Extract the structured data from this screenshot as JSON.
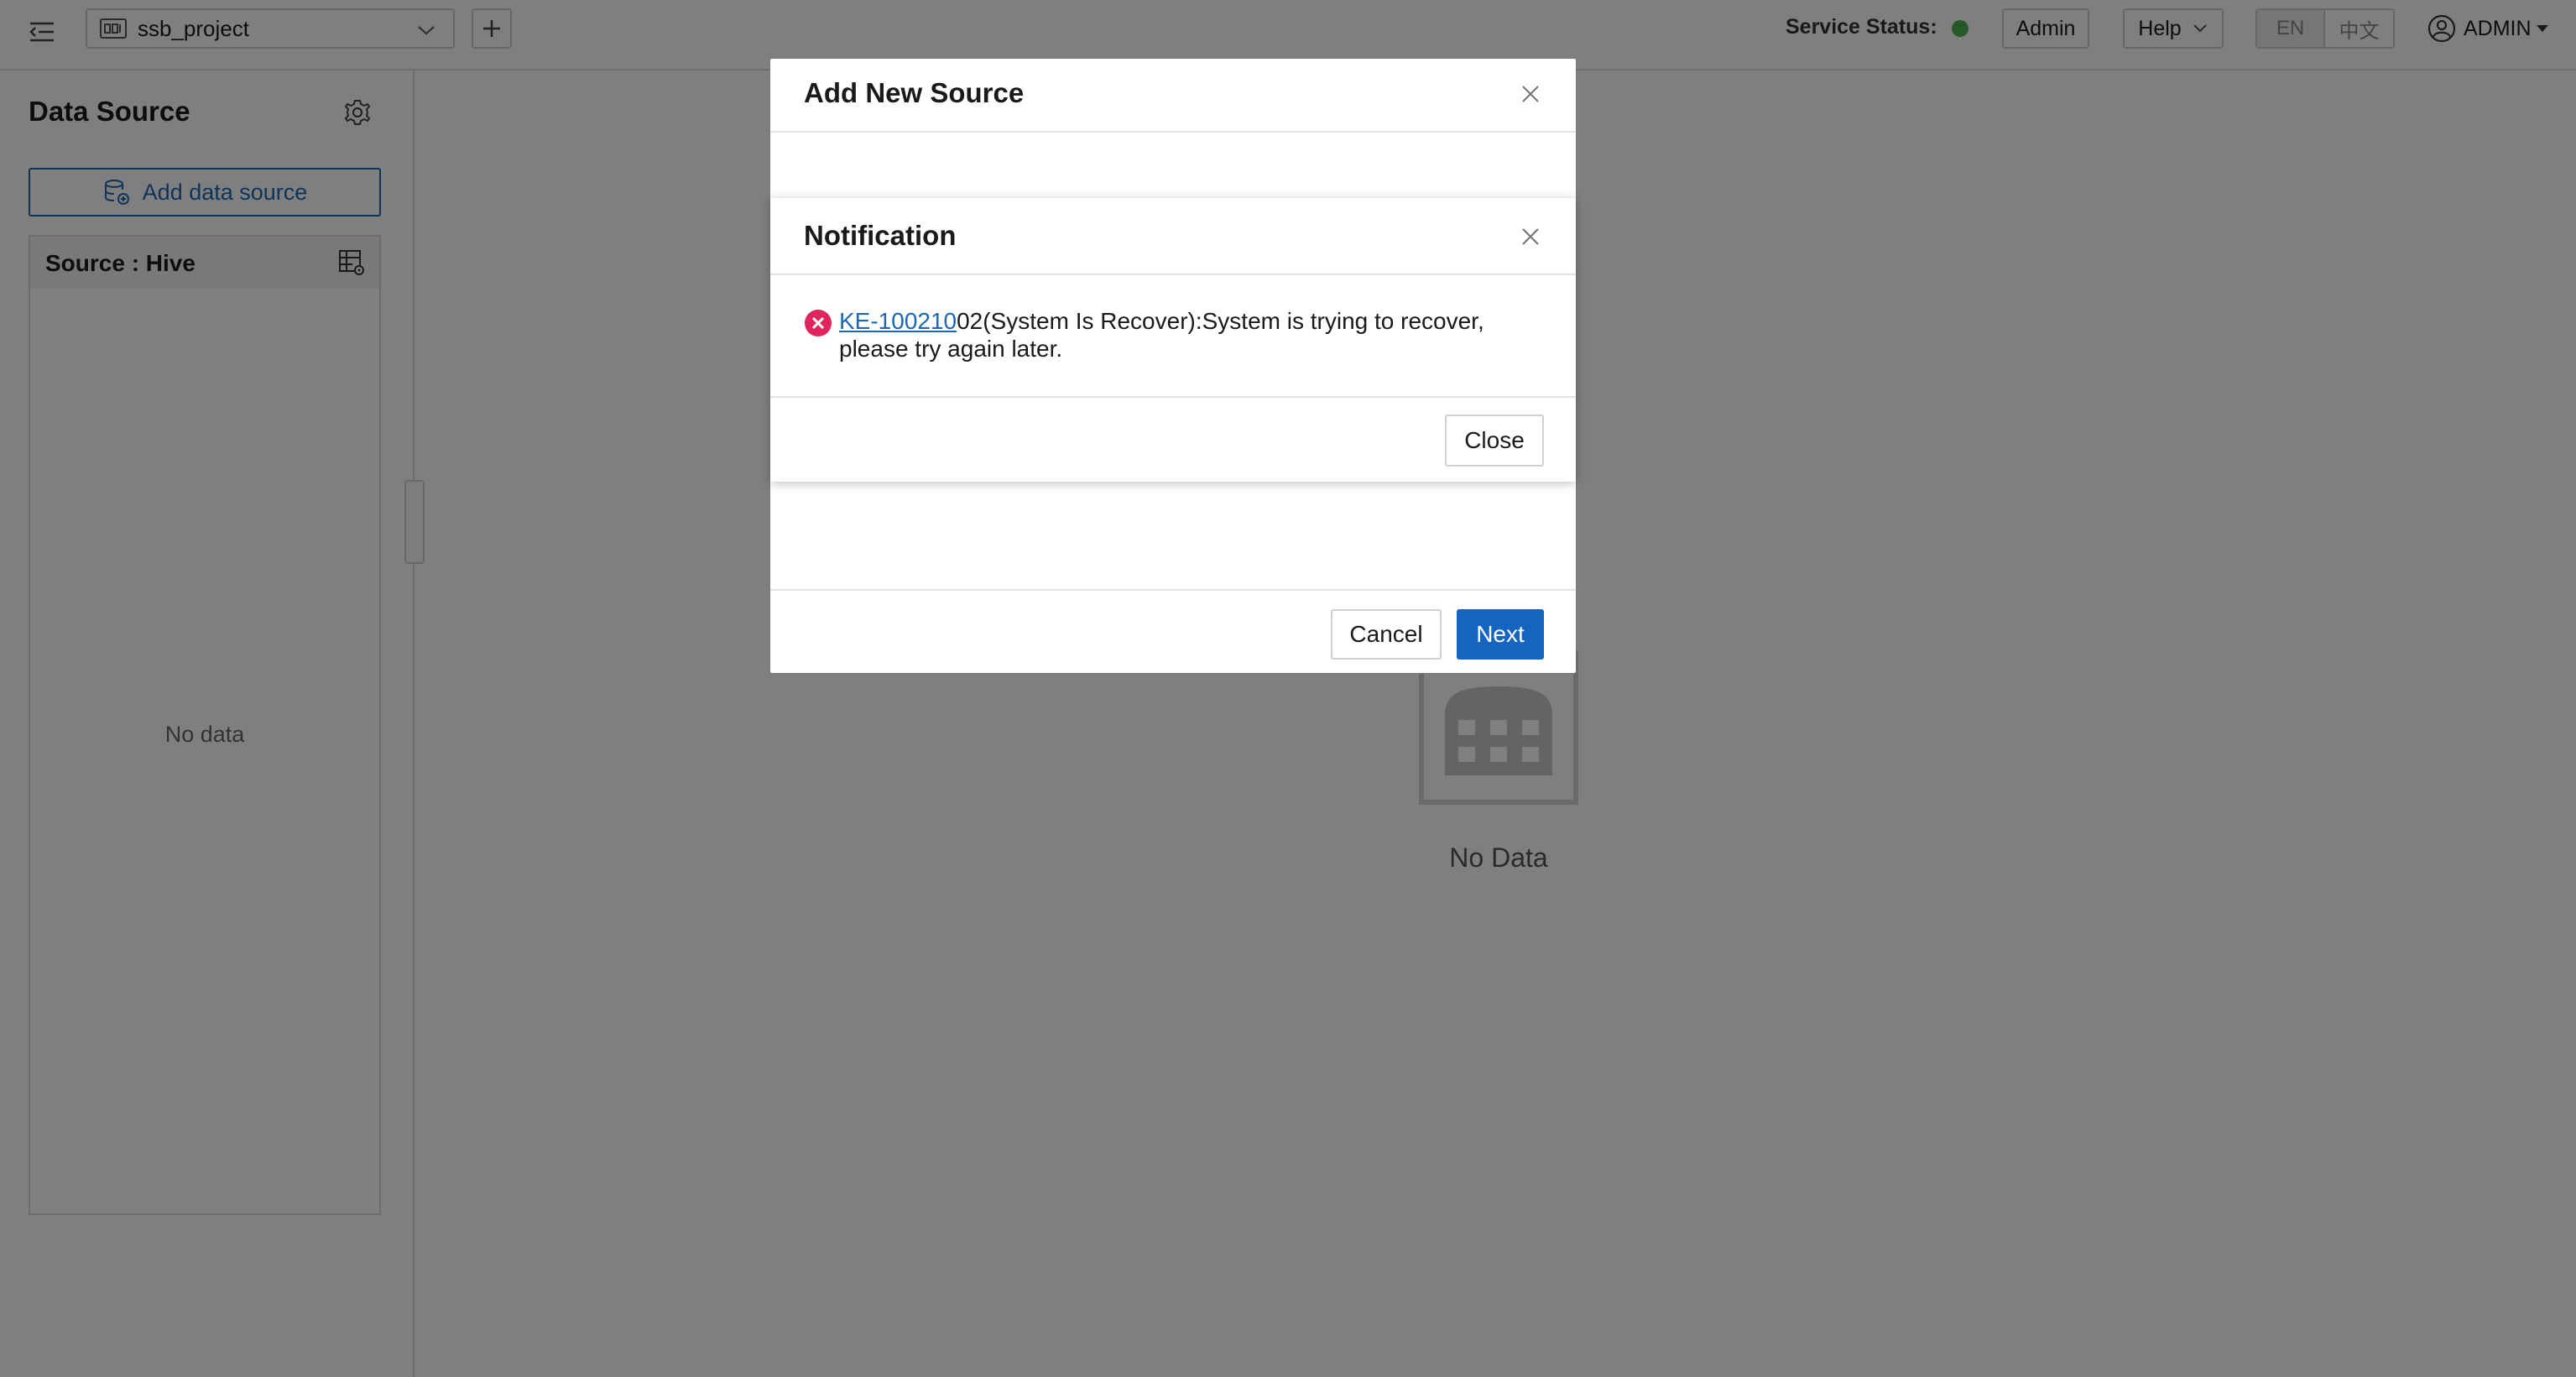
{
  "header": {
    "project_name": "ssb_project",
    "service_status_label": "Service Status:",
    "service_status_color": "#4cb050",
    "admin_label": "Admin",
    "help_label": "Help",
    "lang_en": "EN",
    "lang_zh": "中文",
    "user_name": "ADMIN"
  },
  "sidebar": {
    "title": "Data Source",
    "add_source_label": "Add data source",
    "source_title": "Source : Hive",
    "empty_text": "No data"
  },
  "main": {
    "empty_text": "No Data"
  },
  "add_source_dialog": {
    "title": "Add New Source",
    "cancel_label": "Cancel",
    "next_label": "Next"
  },
  "notification": {
    "title": "Notification",
    "error_code": "KE-100210",
    "message": "02(System Is Recover):System is trying to recover, please try again later.",
    "close_label": "Close"
  },
  "colors": {
    "primary": "#1565c0",
    "link": "#1c68b5",
    "error": "#e0245e",
    "status_ok": "#4cb050"
  },
  "icons": {
    "menu_toggle": "menu-fold-icon",
    "project": "project-icon",
    "chevron": "chevron-down-icon",
    "add_project": "plus-icon",
    "user": "user-circle-icon",
    "gear": "gear-icon",
    "add_source": "database-add-icon",
    "source_settings": "table-settings-icon",
    "close": "close-icon",
    "error": "error-circle-icon",
    "empty": "empty-table-icon"
  }
}
